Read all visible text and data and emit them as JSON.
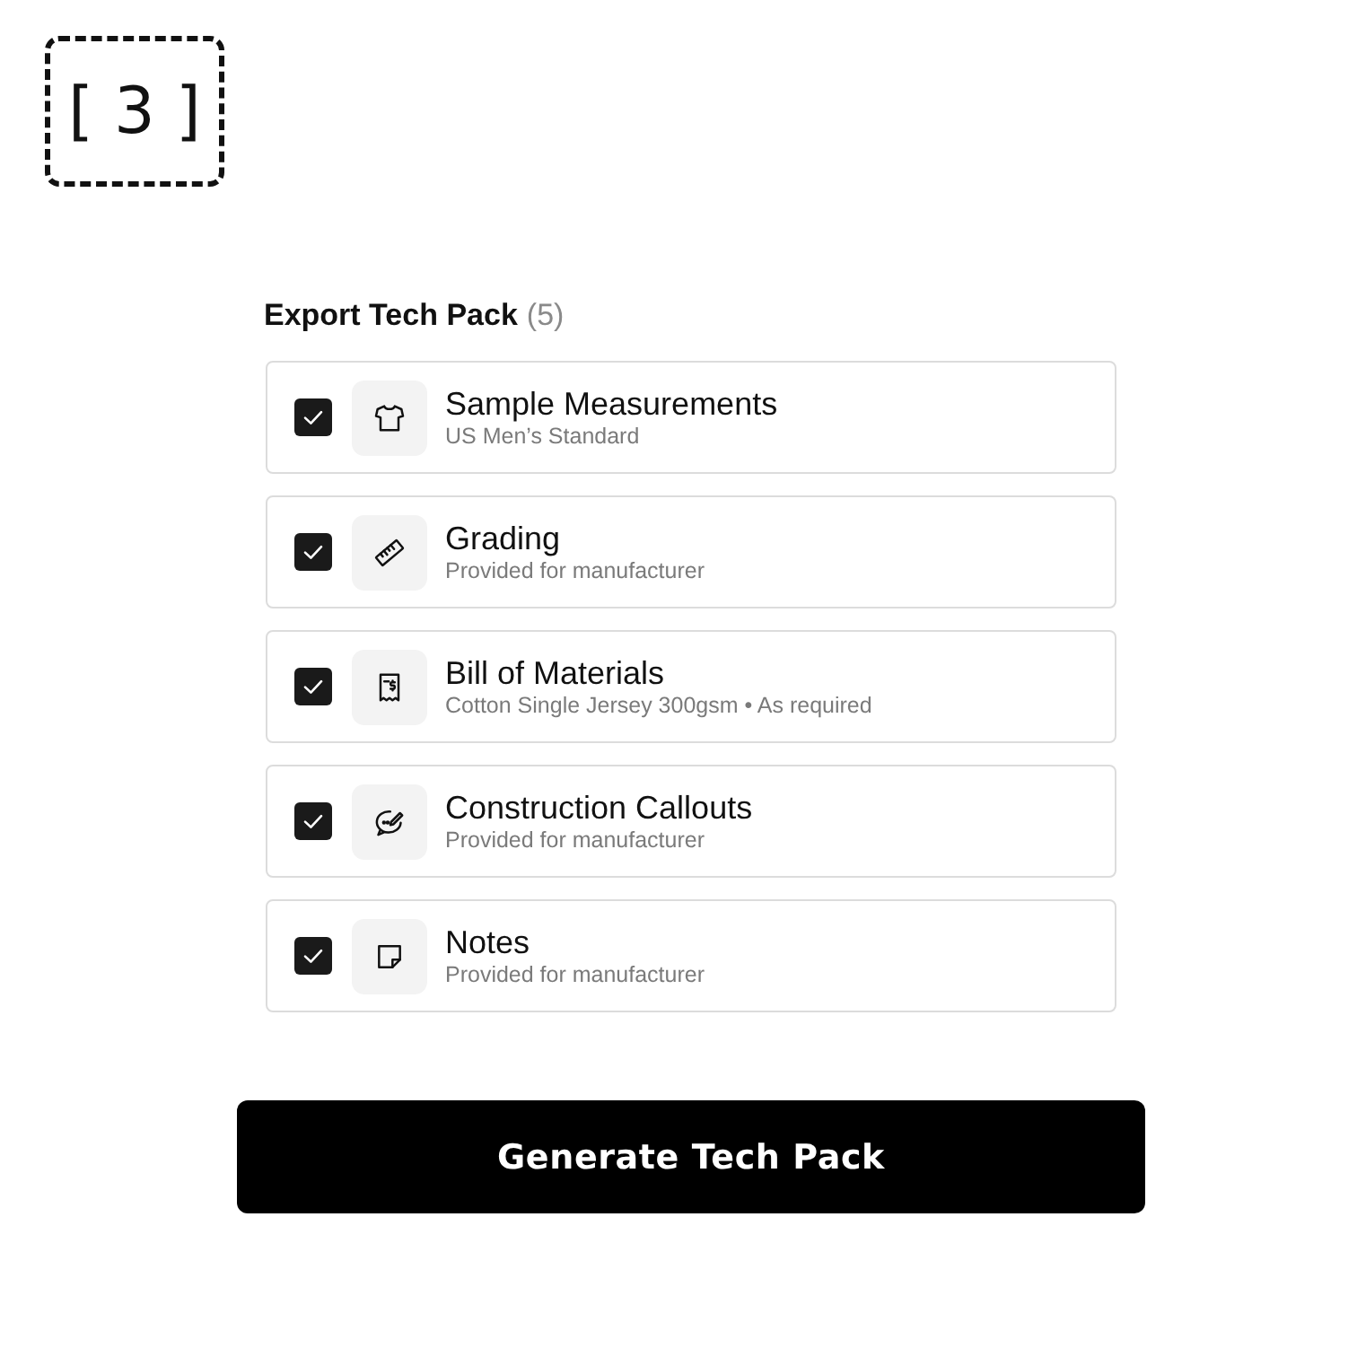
{
  "step_badge": {
    "label": "[ 3 ]"
  },
  "export_panel": {
    "title": "Export Tech Pack",
    "count": "(5)",
    "items": [
      {
        "title": "Sample Measurements",
        "subtitle": "US Men’s Standard",
        "checked": true
      },
      {
        "title": "Grading",
        "subtitle": "Provided for manufacturer",
        "checked": true
      },
      {
        "title": "Bill of Materials",
        "subtitle": "Cotton Single Jersey 300gsm • As required",
        "checked": true
      },
      {
        "title": "Construction Callouts",
        "subtitle": "Provided for manufacturer",
        "checked": true
      },
      {
        "title": "Notes",
        "subtitle": "Provided for manufacturer",
        "checked": true
      }
    ]
  },
  "primary_button": {
    "label": "Generate Tech Pack"
  }
}
